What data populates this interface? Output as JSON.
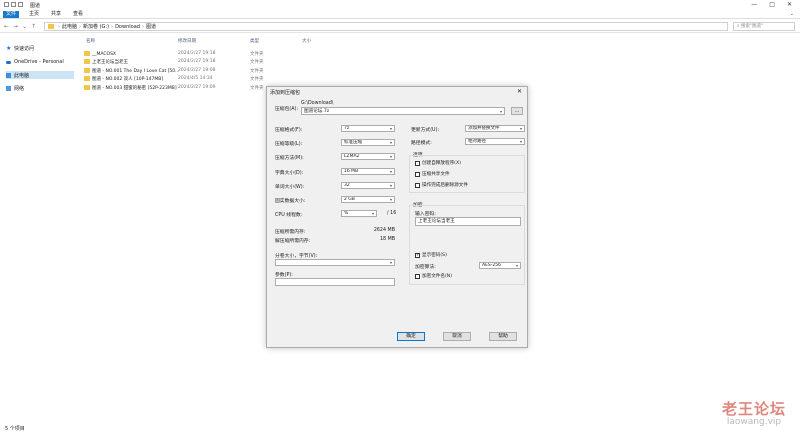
{
  "window": {
    "title": "图道"
  },
  "ribbon": {
    "tabs": [
      "文件",
      "主页",
      "共享",
      "查看"
    ]
  },
  "address": {
    "parts": [
      "此电脑",
      "新加卷 (G:)",
      "Download",
      "图道"
    ],
    "search_placeholder": "搜索\"图道\""
  },
  "sidebar": {
    "items": [
      "快速访问",
      "OneDrive - Personal",
      "此电脑",
      "网络"
    ]
  },
  "files": {
    "headers": [
      "名称",
      "修改日期",
      "类型",
      "大小"
    ],
    "rows": [
      {
        "name": "__MACOSX",
        "date": "2024/2/27 19:18",
        "type": "文件夹"
      },
      {
        "name": "上老王论坛当老王",
        "date": "2024/2/27 19:18",
        "type": "文件夹"
      },
      {
        "name": "图道 - NO.001 The Day I Love Cat [50...",
        "date": "2024/2/27 19:08",
        "type": "文件夹"
      },
      {
        "name": "图道 - NO.002 双人 [10P-147MB]",
        "date": "2024/4/5 14:34",
        "type": "文件夹"
      },
      {
        "name": "图道 - NO.003 甜蜜的秘密 [52P-223MB]",
        "date": "2024/2/27 19:09",
        "type": "文件夹"
      }
    ]
  },
  "status": {
    "count": "5 个项目"
  },
  "dialog": {
    "title": "添加到压缩包",
    "archive_label": "压缩包(A):",
    "archive_path": "G:\\Download\\",
    "archive_name": "图道论坛.7z",
    "browse": "...",
    "left": {
      "format_label": "压缩格式(F):",
      "format": "7z",
      "level_label": "压缩等级(L):",
      "level": "标准压缩",
      "method_label": "压缩方法(M):",
      "method": "LZMA2",
      "dict_label": "字典大小(D):",
      "dict": "16 MB",
      "word_label": "单词大小(W):",
      "word": "32",
      "solid_label": "固实数据大小:",
      "solid": "2 GB",
      "cpu_label": "CPU 线程数:",
      "cpu": "%",
      "cpu_total": "/ 16",
      "mem_comp_label": "压缩所需内存:",
      "mem_comp": "2624 MB",
      "mem_decomp_label": "解压缩所需内存:",
      "mem_decomp": "18 MB",
      "split_label": "分卷大小，字节(V):",
      "params_label": "参数(P):"
    },
    "right": {
      "update_label": "更新方式(U):",
      "update": "添加并替换文件",
      "path_label": "路径模式:",
      "path": "相对路径",
      "options_label": "选项",
      "opt_sfx": "创建自释放程序(X)",
      "opt_shared": "压缩共享文件",
      "opt_delete": "操作完成后删除源文件",
      "enc_label": "加密",
      "pwd_label": "输入密码:",
      "pwd_value": "上老王论坛当老王",
      "show_pwd": "显示密码(S)",
      "enc_method_label": "加密算法:",
      "enc_method": "AES-256",
      "enc_names": "加密文件名(N)"
    },
    "buttons": {
      "ok": "确定",
      "cancel": "取消",
      "help": "帮助"
    }
  },
  "watermark": {
    "text": "老王论坛",
    "url": "laowang.vip"
  }
}
